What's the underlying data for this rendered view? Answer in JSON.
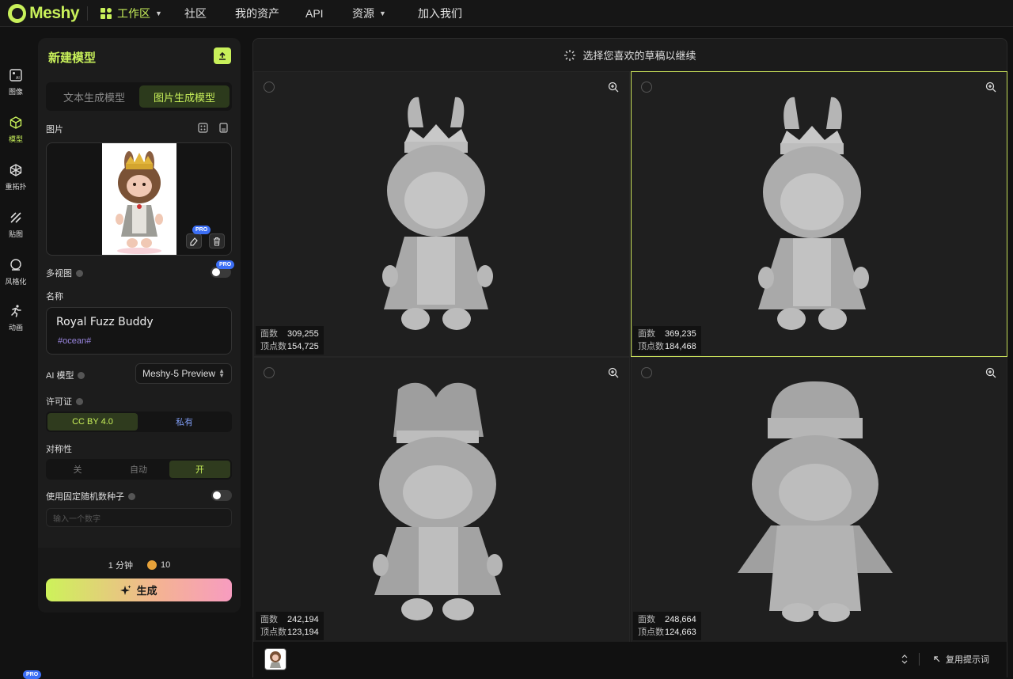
{
  "app": {
    "logo_text": "Meshy"
  },
  "nav": {
    "workspace": "工作区",
    "community": "社区",
    "assets": "我的资产",
    "api": "API",
    "resources": "资源",
    "join": "加入我们"
  },
  "sidebar": {
    "items": [
      {
        "label": "图像",
        "icon": "image-ai-icon"
      },
      {
        "label": "模型",
        "icon": "cube-icon"
      },
      {
        "label": "重拓扑",
        "icon": "retopo-icon"
      },
      {
        "label": "贴图",
        "icon": "texture-icon"
      },
      {
        "label": "风格化",
        "icon": "stylize-icon"
      },
      {
        "label": "动画",
        "icon": "running-icon"
      }
    ],
    "pro": "PRO"
  },
  "panel": {
    "title": "新建模型",
    "tabs": [
      "文本生成模型",
      "图片生成模型"
    ],
    "active_tab": 1,
    "image_label": "图片",
    "pro": "PRO",
    "multiview_label": "多视图",
    "name_label": "名称",
    "name_value": "Royal Fuzz Buddy",
    "name_tag": "#ocean#",
    "ai_model_label": "AI 模型",
    "ai_model_value": "Meshy-5 Preview",
    "license_label": "许可证",
    "license_options": [
      "CC BY 4.0",
      "私有"
    ],
    "license_selected": "CC BY 4.0",
    "symmetry_label": "对称性",
    "symmetry_options": [
      "关",
      "自动",
      "开"
    ],
    "symmetry_selected": "开",
    "seed_label": "使用固定随机数种子",
    "seed_placeholder": "输入一个数字",
    "time": "1 分钟",
    "credits": "10",
    "generate": "生成"
  },
  "main": {
    "header": "选择您喜欢的草稿以继续",
    "faces_label": "面数",
    "verts_label": "顶点数",
    "drafts": [
      {
        "faces": "309,255",
        "verts": "154,725",
        "selected": false
      },
      {
        "faces": "369,235",
        "verts": "184,468",
        "selected": true
      },
      {
        "faces": "242,194",
        "verts": "123,194",
        "selected": false
      },
      {
        "faces": "248,664",
        "verts": "124,663",
        "selected": false
      }
    ],
    "reuse_prompt": "复用提示词"
  },
  "colors": {
    "accent": "#c8f05a",
    "pro_blue": "#3c6ff5",
    "selected_border": "#c8e05a"
  }
}
